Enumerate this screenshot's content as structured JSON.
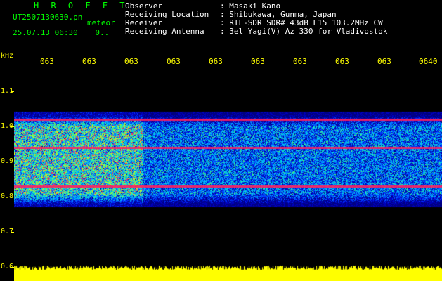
{
  "header": {
    "app_title": "H R O F F T",
    "filename": "UT2507130630.pn",
    "file_type": "meteor",
    "datetime": "25.07.13 06:30",
    "extra": "0.."
  },
  "metadata": [
    {
      "key": "Observer",
      "value": ": Masaki Kano"
    },
    {
      "key": "Receiving Location",
      "value": ": Shibukawa, Gunma, Japan"
    },
    {
      "key": "Receiver",
      "value": ": RTL-SDR SDR# 43dB L15 103.2MHz CW"
    },
    {
      "key": "Receiving Antenna",
      "value": ": 3el Yagi(V) Az 330 for Vladivostok"
    }
  ],
  "axis": {
    "y_unit": "kHz",
    "y_ticks": [
      "1.1",
      "1.0",
      "0.9",
      "0.8",
      "0.7",
      "0.6"
    ],
    "x_ticks": [
      "063",
      "063",
      "063",
      "063",
      "063",
      "063",
      "063",
      "063",
      "063",
      "0640"
    ]
  },
  "colors": {
    "background": "#000000",
    "header_green": "#00ff00",
    "axis_yellow": "#ffff00",
    "signal_line": "#ff2060"
  },
  "spectrogram": {
    "freq_top_khz": 1.02,
    "freq_bottom_khz": 0.75,
    "carrier_lines_khz": [
      1.0,
      0.92,
      0.81
    ],
    "burst_end_fraction": 0.3
  }
}
